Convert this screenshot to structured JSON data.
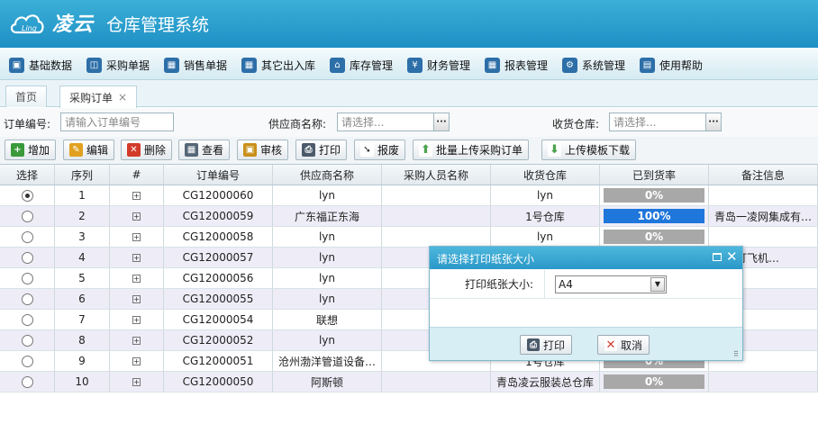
{
  "brand": {
    "logo_small": "Ling",
    "logo_text": "凌云",
    "title": "仓库管理系统"
  },
  "menu": [
    {
      "label": "基础数据",
      "icon": "box-icon"
    },
    {
      "label": "采购单据",
      "icon": "basket-icon"
    },
    {
      "label": "销售单据",
      "icon": "calendar-icon"
    },
    {
      "label": "其它出入库",
      "icon": "calendar-icon"
    },
    {
      "label": "库存管理",
      "icon": "home-icon"
    },
    {
      "label": "财务管理",
      "icon": "money-icon"
    },
    {
      "label": "报表管理",
      "icon": "calendar-icon"
    },
    {
      "label": "系统管理",
      "icon": "gear-icon"
    },
    {
      "label": "使用帮助",
      "icon": "book-icon"
    }
  ],
  "tabs": [
    {
      "label": "首页",
      "active": false
    },
    {
      "label": "采购订单",
      "active": true,
      "close": "×"
    }
  ],
  "search": {
    "order_label": "订单编号:",
    "order_placeholder": "请输入订单编号",
    "supplier_label": "供应商名称:",
    "supplier_placeholder": "请选择...",
    "warehouse_label": "收货仓库:",
    "warehouse_placeholder": "请选择...",
    "dots": "···"
  },
  "toolbar": [
    {
      "label": "增加",
      "icon": "plus-icon",
      "glyph": "+",
      "color": "#3a9a3a"
    },
    {
      "label": "编辑",
      "icon": "edit-icon",
      "glyph": "✎",
      "color": "#e0a020"
    },
    {
      "label": "删除",
      "icon": "delete-icon",
      "glyph": "✕",
      "color": "#d23a2a"
    },
    {
      "label": "查看",
      "icon": "view-icon",
      "glyph": "▦",
      "color": "#556677"
    },
    {
      "label": "审核",
      "icon": "lock-icon",
      "glyph": "▣",
      "color": "#c8901a"
    },
    {
      "label": "打印",
      "icon": "print-icon",
      "glyph": "⎙",
      "color": "#4a5a6a"
    },
    {
      "label": "报废",
      "icon": "arrow-icon",
      "glyph": "➘",
      "color": "#222222"
    },
    {
      "label": "批量上传采购订单",
      "icon": "upload-icon",
      "glyph": "⬆",
      "color": "#4ca34c"
    },
    {
      "label": "上传模板下载",
      "icon": "download-icon",
      "glyph": "⬇",
      "color": "#4ca34c"
    }
  ],
  "grid": {
    "columns": [
      "选择",
      "序列",
      "#",
      "订单编号",
      "供应商名称",
      "采购人员名称",
      "收货仓库",
      "已到货率",
      "备注信息"
    ],
    "expander": "+",
    "rows": [
      {
        "selected": true,
        "seq": "1",
        "code": "CG12000060",
        "supplier": "lyn",
        "buyer": "",
        "warehouse": "lyn",
        "progress": 0,
        "progress_text": "0%",
        "note": ""
      },
      {
        "selected": false,
        "seq": "2",
        "code": "CG12000059",
        "supplier": "广东福正东海",
        "buyer": "",
        "warehouse": "1号仓库",
        "progress": 100,
        "progress_text": "100%",
        "note": "青岛一凌网集成有…"
      },
      {
        "selected": false,
        "seq": "3",
        "code": "CG12000058",
        "supplier": "lyn",
        "buyer": "",
        "warehouse": "lyn",
        "progress": 0,
        "progress_text": "0%",
        "note": ""
      },
      {
        "selected": false,
        "seq": "4",
        "code": "CG12000057",
        "supplier": "lyn",
        "buyer": "",
        "warehouse": "",
        "progress": 0,
        "progress_text": "",
        "note": "弗森打飞机…"
      },
      {
        "selected": false,
        "seq": "5",
        "code": "CG12000056",
        "supplier": "lyn",
        "buyer": "",
        "warehouse": "",
        "progress": 0,
        "progress_text": "",
        "note": ""
      },
      {
        "selected": false,
        "seq": "6",
        "code": "CG12000055",
        "supplier": "lyn",
        "buyer": "",
        "warehouse": "",
        "progress": 0,
        "progress_text": "",
        "note": ""
      },
      {
        "selected": false,
        "seq": "7",
        "code": "CG12000054",
        "supplier": "联想",
        "buyer": "",
        "warehouse": "",
        "progress": 0,
        "progress_text": "",
        "note": ""
      },
      {
        "selected": false,
        "seq": "8",
        "code": "CG12000052",
        "supplier": "lyn",
        "buyer": "",
        "warehouse": "",
        "progress": 0,
        "progress_text": "",
        "note": ""
      },
      {
        "selected": false,
        "seq": "9",
        "code": "CG12000051",
        "supplier": "沧州渤洋管道设备…",
        "buyer": "",
        "warehouse": "1号仓库",
        "progress": 0,
        "progress_text": "0%",
        "note": ""
      },
      {
        "selected": false,
        "seq": "10",
        "code": "CG12000050",
        "supplier": "阿斯顿",
        "buyer": "",
        "warehouse": "青岛凌云服装总仓库",
        "progress": 0,
        "progress_text": "0%",
        "note": ""
      }
    ]
  },
  "dialog": {
    "title": "请选择打印纸张大小",
    "close": "✕",
    "paper_label": "打印纸张大小:",
    "paper_value": "A4",
    "arrow": "▼",
    "print_label": "打印",
    "cancel_label": "取消",
    "print_glyph": "⎙",
    "cancel_glyph": "✕",
    "resize": "⠿"
  }
}
